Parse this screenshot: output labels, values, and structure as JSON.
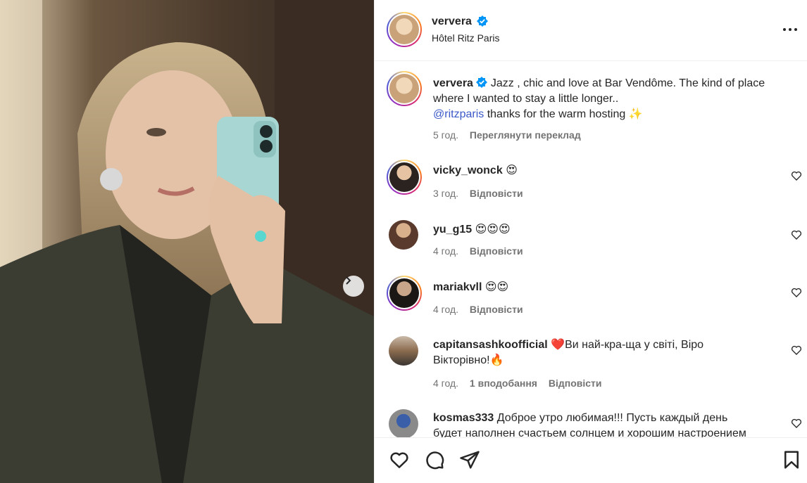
{
  "post": {
    "username": "ververa",
    "location": "Hôtel Ritz Paris",
    "caption_line1": "Jazz , chic and love at Bar Vendôme. The kind of place",
    "caption_line2": "where I wanted to stay a little longer..",
    "caption_mention": "@ritzparis",
    "caption_line3_rest": " thanks for the warm hosting ✨",
    "time": "5 год.",
    "translate": "Переглянути переклад"
  },
  "comments": [
    {
      "username": "vicky_wonck",
      "text": "😍",
      "time": "3 год.",
      "likes": "",
      "reply": "Відповісти"
    },
    {
      "username": "yu_g15",
      "text": "😍😍😍",
      "time": "4 год.",
      "likes": "",
      "reply": "Відповісти"
    },
    {
      "username": "mariakvll",
      "text": "😍😍",
      "time": "4 год.",
      "likes": "",
      "reply": "Відповісти"
    },
    {
      "username": "capitansashkoofficial",
      "text_line1": "❤️Ви най-кра-ща у світі, Віро",
      "text_line2": "Вікторівно!🔥",
      "time": "4 год.",
      "likes": "1 вподобання",
      "reply": "Відповісти"
    },
    {
      "username": "kosmas333",
      "text_line1": "Доброе утро любимая!!! Пусть каждый день",
      "text_line2": "будет наполнен счастьем солнцем и хорошим настроением"
    }
  ],
  "icons": {
    "verified": "verified-badge-icon",
    "more": "more-options-icon",
    "like": "heart-icon",
    "comment": "comment-icon",
    "share": "share-icon",
    "save": "bookmark-icon",
    "next": "chevron-right-icon"
  },
  "colors": {
    "accent": "#0095f6",
    "mention": "#3b58c8",
    "text": "#262626",
    "muted": "#737373"
  }
}
